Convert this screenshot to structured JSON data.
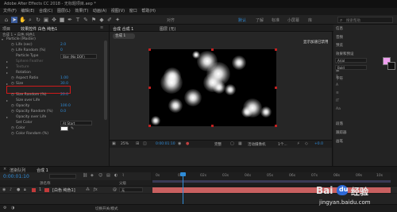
{
  "window": {
    "title": "Adobe After Effects CC 2018 - 无标题项目.aep *"
  },
  "menu": [
    "文件(F)",
    "编辑(E)",
    "合成(C)",
    "图层(L)",
    "效果(T)",
    "动画(A)",
    "视图(V)",
    "窗口",
    "帮助(H)"
  ],
  "toolbar": {
    "snapping": "对齐",
    "workspace_default": "默认",
    "workspace_learn": "了解",
    "workspace_standard": "标准",
    "workspace_small": "小屏幕",
    "workspace_libraries": "库",
    "search_placeholder": "搜索帮助"
  },
  "left_panel": {
    "tabs": [
      "项目",
      "效果控件 白色 纯色1"
    ],
    "comp_path": "合成 1 • 白色 纯色1",
    "rows": [
      {
        "label": "Particle (Master)",
        "value": ""
      },
      {
        "label": "Life (sec)",
        "value": "2.0"
      },
      {
        "label": "Life Random (%)",
        "value": "0"
      },
      {
        "label": "Particle Type",
        "value": "Star (No DOF)"
      },
      {
        "label": "Sphere Feather",
        "value": ""
      },
      {
        "label": "Texture",
        "value": ""
      },
      {
        "label": "Rotation",
        "value": ""
      },
      {
        "label": "Aspect Ratio",
        "value": "1.00"
      },
      {
        "label": "Size",
        "value": "30.0"
      },
      {
        "label": "Size Random (%)",
        "value": "20.0"
      },
      {
        "label": "Size over Life",
        "value": ""
      },
      {
        "label": "Opacity",
        "value": "100.0"
      },
      {
        "label": "Opacity Random (%)",
        "value": "0.0"
      },
      {
        "label": "Opacity over Life",
        "value": ""
      },
      {
        "label": "Set Color",
        "value": "At Start"
      },
      {
        "label": "Color",
        "value": ""
      },
      {
        "label": "Color Random (%)",
        "value": ""
      }
    ]
  },
  "viewer": {
    "tabs": [
      "合成 合成 1",
      "图层 (无)"
    ],
    "breadcrumb": "合成 1",
    "info_text": "显示加速已禁用",
    "zoom": "25%",
    "timecode": "0:00:01:10",
    "resolution": "完整",
    "camera": "活动摄像机",
    "views": "1个...",
    "exposure": "+0.0"
  },
  "right_panel": {
    "tabs": [
      "信息",
      "音频",
      "预览",
      "效果和预设",
      "对齐",
      "库",
      "字符",
      "段落",
      "跟踪器",
      "画笔"
    ],
    "font": "Arial",
    "font_style": "Bold",
    "colors": {
      "fill": "#f0a0f0",
      "stroke": "#111111"
    },
    "tracker_label": "跟踪器",
    "brush_label": "画笔"
  },
  "timeline": {
    "tabs": [
      "渲染队列",
      "合成 1"
    ],
    "timecode": "0:00:01:10",
    "column_headers": [
      "源名称",
      "父级"
    ],
    "layer": {
      "index": "1",
      "name": "[白色 纯色1]",
      "parent": "无"
    },
    "ruler": [
      "0s",
      "01s",
      "02s",
      "03s",
      "04s",
      "05s",
      "06s",
      "07s",
      "08s",
      "09s",
      "10s"
    ],
    "footer": "切换开关/模式"
  },
  "watermark": {
    "brand": "Bai",
    "paw": "du",
    "site_cn": "经验",
    "site_url": "jingyan.baidu.com"
  }
}
